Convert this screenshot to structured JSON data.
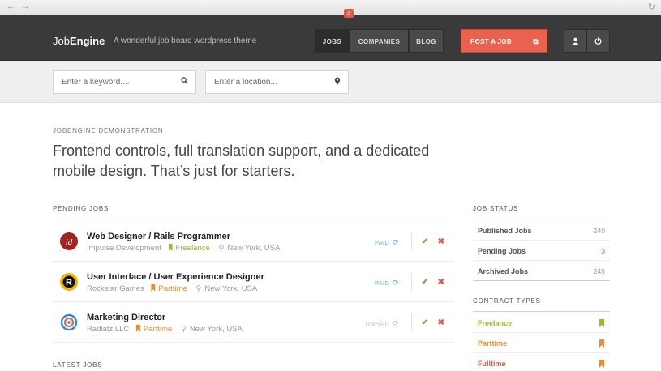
{
  "browser": {
    "nav_arrows": "← →",
    "reload": "↻"
  },
  "header": {
    "brand_light": "Job",
    "brand_bold": "Engine",
    "tagline": "A wonderful job board wordpress theme",
    "nav": [
      {
        "label": "JOBS",
        "badge": "3"
      },
      {
        "label": "COMPANIES"
      },
      {
        "label": "BLOG"
      }
    ],
    "post_job_label": "POST A JOB",
    "post_job_icon": "external-link-icon",
    "user_icon": "user-icon",
    "power_icon": "power-icon"
  },
  "search": {
    "keyword_placeholder": "Enter a keyword....",
    "location_placeholder": "Enter a location...",
    "keyword_icon": "search-icon",
    "location_icon": "map-pin-icon"
  },
  "intro": {
    "kicker": "JOBENGINE DEMONSTRATION",
    "headline_line1": "Frontend controls, full translation support, and a dedicated",
    "headline_line2": "mobile design. That’s just for starters."
  },
  "pending": {
    "title": "PENDING JOBS",
    "jobs": [
      {
        "title": "Web Designer / Rails Programmer",
        "company": "Impulse Development",
        "contract": "Freelance",
        "location": "New York, USA",
        "status": "PAID",
        "logo_color": "#a0231f",
        "logo_text": "id"
      },
      {
        "title": "User Interface / User Experience Designer",
        "company": "Rockstar Games",
        "contract": "Parttime",
        "location": "New York, USA",
        "status": "PAID",
        "logo_color": "#f1b400",
        "logo_text": "R"
      },
      {
        "title": "Marketing Director",
        "company": "Radiatz LLC",
        "contract": "Parttime",
        "location": "New York, USA",
        "status": "UNPAID",
        "logo_color": "#2b8fd6",
        "logo_text": "◎"
      }
    ]
  },
  "latest": {
    "title": "LATEST JOBS"
  },
  "job_status": {
    "title": "JOB STATUS",
    "rows": [
      {
        "label": "Published Jobs",
        "count": "240"
      },
      {
        "label": "Pending Jobs",
        "count": "3"
      },
      {
        "label": "Archived Jobs",
        "count": "245"
      }
    ]
  },
  "contract_types": {
    "title": "CONTRACT TYPES",
    "rows": [
      {
        "label": "Freelance",
        "color": "#8fbf2a"
      },
      {
        "label": "Parttime",
        "color": "#ee8c2f"
      },
      {
        "label": "Fulltime",
        "color": "#e05a4b"
      }
    ]
  },
  "colors": {
    "accent": "#e8624f",
    "header_bg": "#3a3a3a",
    "paid": "#5aa9d6",
    "unpaid": "#bbbbbb",
    "freelance": "#8fbf2a",
    "parttime": "#ee8c2f",
    "fulltime": "#e05a4b"
  }
}
